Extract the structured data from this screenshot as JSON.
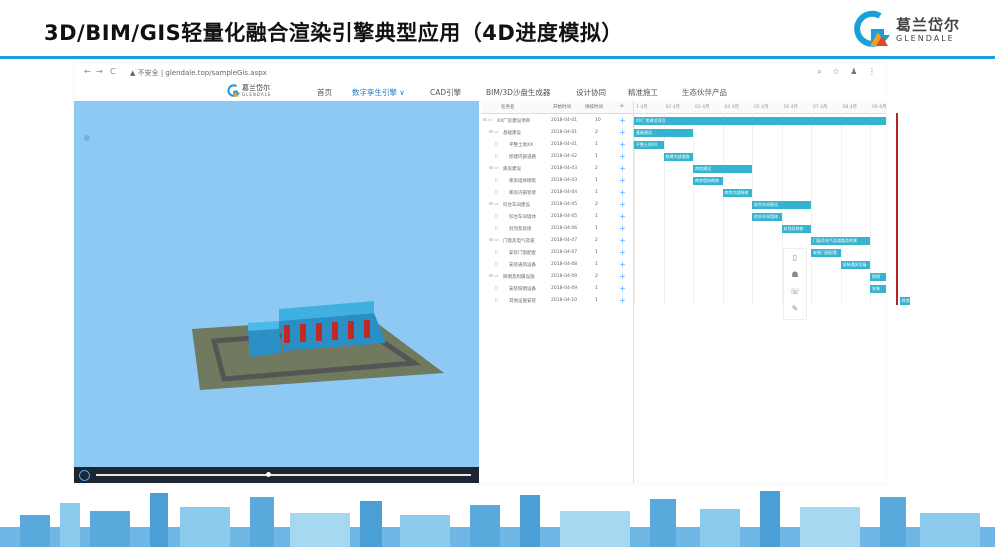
{
  "slide": {
    "title": "3D/BIM/GIS轻量化融合渲染引擎典型应用（4D进度模拟）",
    "logo_cn": "葛兰岱尔",
    "logo_en": "GLENDALE"
  },
  "browser": {
    "back": "←",
    "forward": "→",
    "reload": "C",
    "url": "▲ 不安全 | glendale.top/sampleGis.aspx",
    "icons": [
      "⌕",
      "☆",
      "♟",
      "⋮"
    ]
  },
  "app": {
    "logo_cn": "葛兰岱尔",
    "logo_en": "GLENDALE",
    "nav": [
      {
        "label": "首页",
        "active": false
      },
      {
        "label": "数字孪生引擎 ∨",
        "active": true
      },
      {
        "label": "CAD引擎",
        "active": false
      },
      {
        "label": "BIM/3D沙盘生成器",
        "active": false
      },
      {
        "label": "设计协同",
        "active": false
      },
      {
        "label": "精准施工",
        "active": false
      },
      {
        "label": "生态伙伴产品",
        "active": false
      }
    ]
  },
  "gantt": {
    "headers": [
      "任务名",
      "开始时间",
      "持续时间",
      "+"
    ],
    "timeline": [
      "1 4月",
      "02 4月",
      "03 4月",
      "04 4月",
      "05 4月",
      "06 4月",
      "07 4月",
      "08 4月",
      "09 4月"
    ],
    "rows": [
      {
        "name": "XX厂房建设项目",
        "start": "2018-04-01",
        "dur": "10",
        "level": 0,
        "type": "folder"
      },
      {
        "name": "基础建设",
        "start": "2018-04-01",
        "dur": "2",
        "level": 1,
        "type": "folder"
      },
      {
        "name": "平整土地XX",
        "start": "2018-04-01",
        "dur": "1",
        "level": 2,
        "type": "file"
      },
      {
        "name": "修建内部道路",
        "start": "2018-04-02",
        "dur": "1",
        "level": 2,
        "type": "file"
      },
      {
        "name": "库房建设",
        "start": "2018-04-03",
        "dur": "2",
        "level": 1,
        "type": "folder"
      },
      {
        "name": "库房墙体砌筑",
        "start": "2018-04-03",
        "dur": "1",
        "level": 2,
        "type": "file"
      },
      {
        "name": "库房内部装修",
        "start": "2018-04-04",
        "dur": "1",
        "level": 2,
        "type": "file"
      },
      {
        "name": "综合车间建设",
        "start": "2018-04-05",
        "dur": "2",
        "level": 1,
        "type": "folder"
      },
      {
        "name": "综合车间墙体",
        "start": "2018-04-05",
        "dur": "1",
        "level": 2,
        "type": "file"
      },
      {
        "name": "封顶及装修",
        "start": "2018-04-06",
        "dur": "1",
        "level": 2,
        "type": "file"
      },
      {
        "name": "门窗及电气及道",
        "start": "2018-04-07",
        "dur": "2",
        "level": 1,
        "type": "folder"
      },
      {
        "name": "安装门窗配套",
        "start": "2018-04-07",
        "dur": "1",
        "level": 2,
        "type": "file"
      },
      {
        "name": "安装通风设备",
        "start": "2018-04-08",
        "dur": "1",
        "level": 2,
        "type": "file"
      },
      {
        "name": "照明及附属设施",
        "start": "2018-04-09",
        "dur": "2",
        "level": 1,
        "type": "folder"
      },
      {
        "name": "安装照明设备",
        "start": "2018-04-09",
        "dur": "1",
        "level": 2,
        "type": "file"
      },
      {
        "name": "其他设施安装",
        "start": "2018-04-10",
        "dur": "1",
        "level": 2,
        "type": "file"
      }
    ],
    "bars": [
      {
        "label": "XX厂房建设项目",
        "start": 0,
        "dur": 10
      },
      {
        "label": "基础建设",
        "start": 0,
        "dur": 2
      },
      {
        "label": "平整土地XX",
        "start": 0,
        "dur": 1
      },
      {
        "label": "修建内部道路",
        "start": 1,
        "dur": 1
      },
      {
        "label": "库房建设",
        "start": 2,
        "dur": 2
      },
      {
        "label": "库房墙体砌筑",
        "start": 2,
        "dur": 1
      },
      {
        "label": "库房内部装修",
        "start": 3,
        "dur": 1
      },
      {
        "label": "综合车间建设",
        "start": 4,
        "dur": 2
      },
      {
        "label": "综合车间墙体",
        "start": 4,
        "dur": 1
      },
      {
        "label": "封顶及装修",
        "start": 5,
        "dur": 1
      },
      {
        "label": "门窗及电气及道路及附属",
        "start": 6,
        "dur": 2
      },
      {
        "label": "安装门窗配套",
        "start": 6,
        "dur": 1
      },
      {
        "label": "安装通风设备",
        "start": 7,
        "dur": 1
      },
      {
        "label": "照明",
        "start": 8,
        "dur": 2
      },
      {
        "label": "安装",
        "start": 8,
        "dur": 1
      },
      {
        "label": "其他",
        "start": 9,
        "dur": 1
      }
    ]
  },
  "side_tools": [
    "▯",
    "☗",
    "☏",
    "✎"
  ],
  "colors": {
    "accent": "#1aa0d8",
    "bar": "#35b4cf",
    "today": "#b32424",
    "sky": "#8ec9f3"
  }
}
